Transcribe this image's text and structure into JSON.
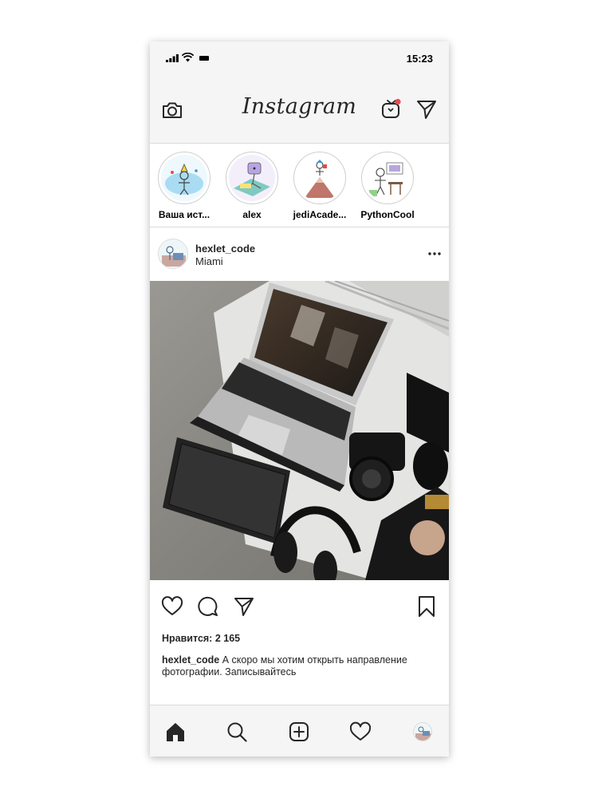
{
  "status_bar": {
    "time": "15:23"
  },
  "header": {
    "logo_text": "Instagram",
    "camera_icon": "camera-icon",
    "igtv_icon": "igtv-icon",
    "direct_icon": "paper-plane-icon",
    "notification_dot_color": "#ed4956"
  },
  "stories": [
    {
      "label": "Ваша ист..."
    },
    {
      "label": "alex"
    },
    {
      "label": "jediAcade..."
    },
    {
      "label": "PythonCool"
    }
  ],
  "post": {
    "username": "hexlet_code",
    "location": "Miami",
    "likes_text": "Нравится: 2 165",
    "caption_user": "hexlet_code",
    "caption_text": " А скоро мы хотим открыть направление фотографии. Записывайтесь"
  },
  "bottom_nav": [
    {
      "icon": "home-icon"
    },
    {
      "icon": "search-icon"
    },
    {
      "icon": "add-post-icon"
    },
    {
      "icon": "heart-icon"
    },
    {
      "icon": "profile-avatar"
    }
  ]
}
